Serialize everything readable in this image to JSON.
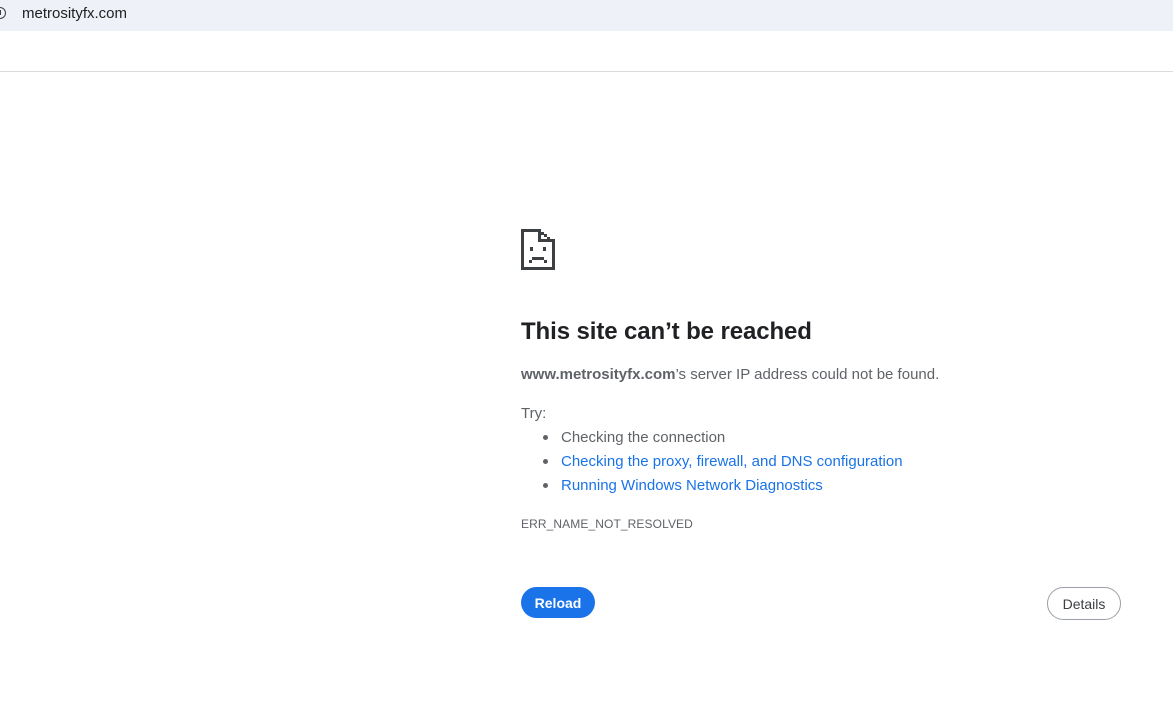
{
  "address_bar": {
    "url": "metrosityfx.com",
    "site_info_icon": "info-circle-icon"
  },
  "error_page": {
    "icon": "sad-page-icon",
    "heading": "This site can’t be reached",
    "message_domain": "www.metrosityfx.com",
    "message_rest": "’s server IP address could not be found.",
    "try_label": "Try:",
    "suggestions": [
      {
        "label": "Checking the connection",
        "is_link": false
      },
      {
        "label": "Checking the proxy, firewall, and DNS configuration",
        "is_link": true
      },
      {
        "label": "Running Windows Network Diagnostics",
        "is_link": true
      }
    ],
    "error_code": "ERR_NAME_NOT_RESOLVED",
    "reload_label": "Reload",
    "details_label": "Details"
  },
  "colors": {
    "link": "#1a73e8",
    "primary_button": "#1a73e8",
    "address_bar_bg": "#eef1f8",
    "secondary_text": "#5f6368"
  }
}
